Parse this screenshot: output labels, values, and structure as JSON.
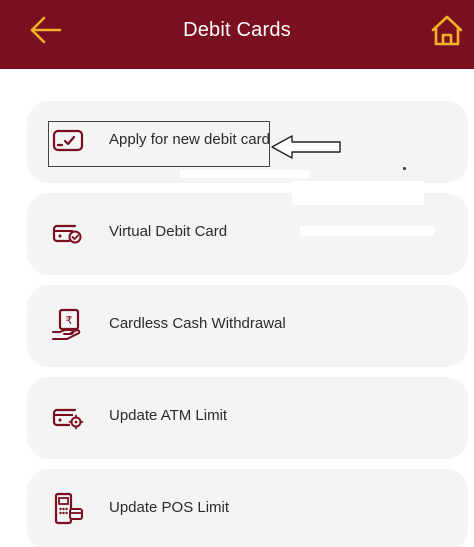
{
  "header": {
    "title": "Debit Cards",
    "back_icon": "back-arrow-icon",
    "home_icon": "home-icon"
  },
  "colors": {
    "header_bg": "#7a0f1f",
    "accent": "#f2b12b",
    "icon": "#7a0f1f",
    "card_bg": "#f4f4f4"
  },
  "menu": {
    "items": [
      {
        "label": "Apply for new debit card",
        "icon": "card-check-icon"
      },
      {
        "label": "Virtual Debit Card",
        "icon": "virtual-card-icon"
      },
      {
        "label": "Cardless Cash Withdrawal",
        "icon": "cash-hand-icon"
      },
      {
        "label": "Update ATM Limit",
        "icon": "card-settings-icon"
      },
      {
        "label": "Update POS Limit",
        "icon": "pos-terminal-icon"
      }
    ]
  }
}
